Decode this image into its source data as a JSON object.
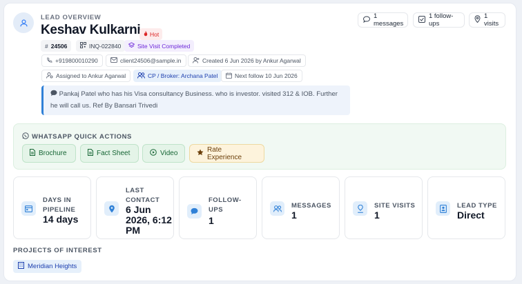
{
  "header": {
    "section_label": "LEAD OVERVIEW",
    "name": "Keshav Kulkarni",
    "temperature": "Hot"
  },
  "tags": {
    "lead_id": "24506",
    "inquiry_id": "INQ-022840",
    "stage": "Site Visit Completed"
  },
  "contact": {
    "phone": "+919800010290",
    "email": "client24506@sample.in",
    "created": "Created 6 Jun 2026 by Ankur Agarwal"
  },
  "assignment": {
    "assigned": "Assigned to Ankur Agarwal",
    "broker": "CP / Broker: Archana Patel",
    "next_follow": "Next follow 10 Jun 2026"
  },
  "stats": {
    "messages": "1 messages",
    "followups": "1 follow-ups",
    "visits": "1 visits"
  },
  "note": "Pankaj Patel who has his Visa consultancy Business. who is investor. visited 312 & IOB. Further he will call us. Ref By Bansari Trivedi",
  "whatsapp": {
    "title": "WHATSAPP QUICK ACTIONS",
    "buttons": [
      "Brochure",
      "Fact Sheet",
      "Video",
      "Rate Experience"
    ]
  },
  "metrics": [
    {
      "label": "DAYS IN PIPELINE",
      "value": "14 days",
      "icon": "calendar-icon"
    },
    {
      "label": "LAST CONTACT",
      "value": "6 Jun 2026, 6:12 PM",
      "icon": "location-pin-icon"
    },
    {
      "label": "FOLLOW-UPS",
      "value": "1",
      "icon": "chat-bubble-icon"
    },
    {
      "label": "MESSAGES",
      "value": "1",
      "icon": "users-icon"
    },
    {
      "label": "SITE VISITS",
      "value": "1",
      "icon": "map-pin-icon"
    },
    {
      "label": "LEAD TYPE",
      "value": "Direct",
      "icon": "id-badge-icon"
    }
  ],
  "projects": {
    "title": "PROJECTS OF INTEREST",
    "items": [
      "Meridian Heights"
    ]
  },
  "colors": {
    "accent": "#2f80d7",
    "hot": "#dc2626",
    "whatsapp": "#166534",
    "rate": "#6b3f0a"
  }
}
